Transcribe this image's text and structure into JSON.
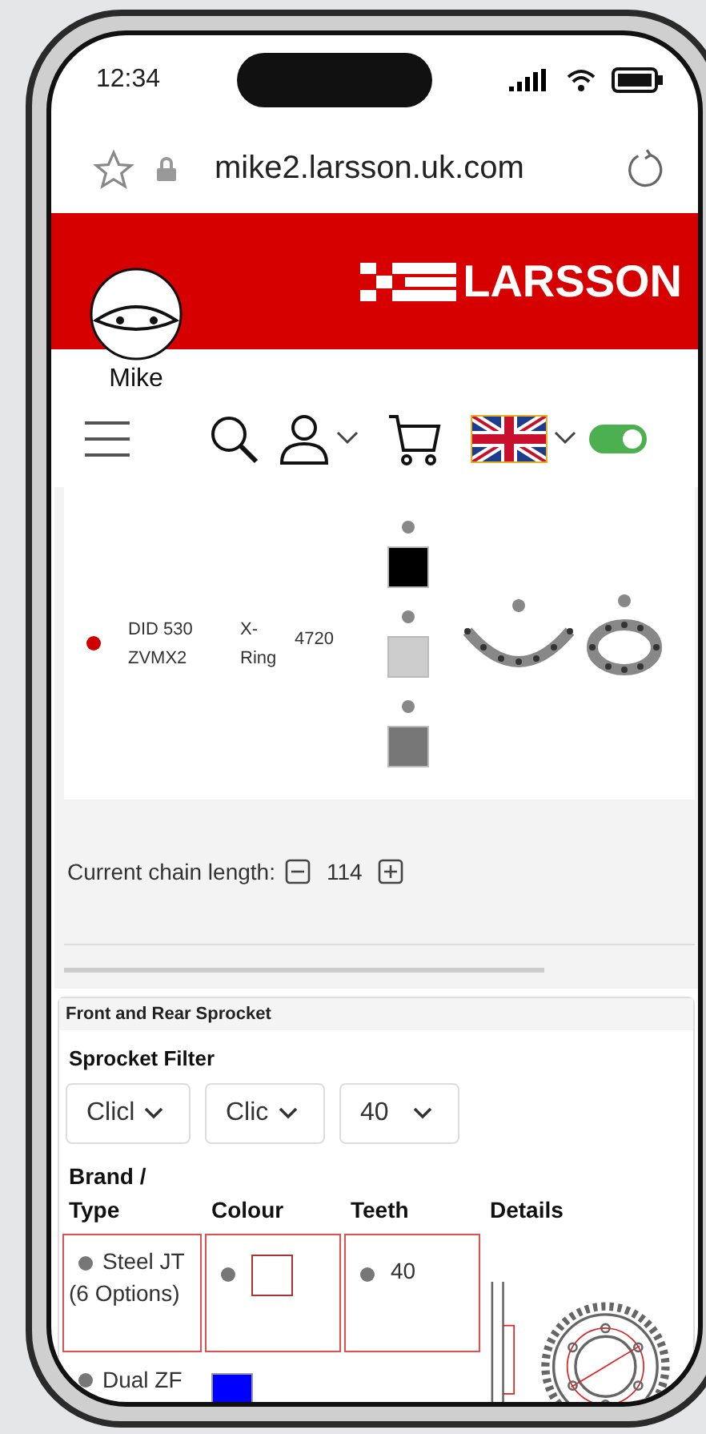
{
  "status_bar": {
    "time": "12:34"
  },
  "browser": {
    "url": "mike2.larsson.uk.com"
  },
  "header": {
    "logo": "LARSSON",
    "user": "Mike"
  },
  "nav": {
    "toggle": {
      "on": true
    }
  },
  "chain": {
    "selected": true,
    "color": "#cc0000",
    "name": "DID 530 ZVMX2",
    "type": "X-Ring",
    "code": "4720",
    "colours": [
      {
        "color": "#000000",
        "selected": false
      },
      {
        "color": "#cccccc",
        "selected": false
      },
      {
        "color": "#777777",
        "selected": false
      }
    ],
    "styles": [
      {
        "kind": "open",
        "selected": false
      },
      {
        "kind": "closed",
        "selected": false
      }
    ]
  },
  "chain_length": {
    "label": "Current chain length:",
    "value": "114"
  },
  "sprocket": {
    "title": "Front and Rear Sprocket",
    "filter_title": "Sprocket Filter",
    "filters": [
      "Clicl",
      "Clic",
      "40"
    ],
    "columns": [
      "Brand / Type",
      "Colour",
      "Teeth",
      "Details"
    ],
    "rows": [
      {
        "selected": true,
        "brand": "Steel JT (6 Options)",
        "color": "#ffffff",
        "teeth": "40"
      },
      {
        "selected": false,
        "brand": "Dual ZF",
        "color": "#0000ff"
      }
    ]
  }
}
